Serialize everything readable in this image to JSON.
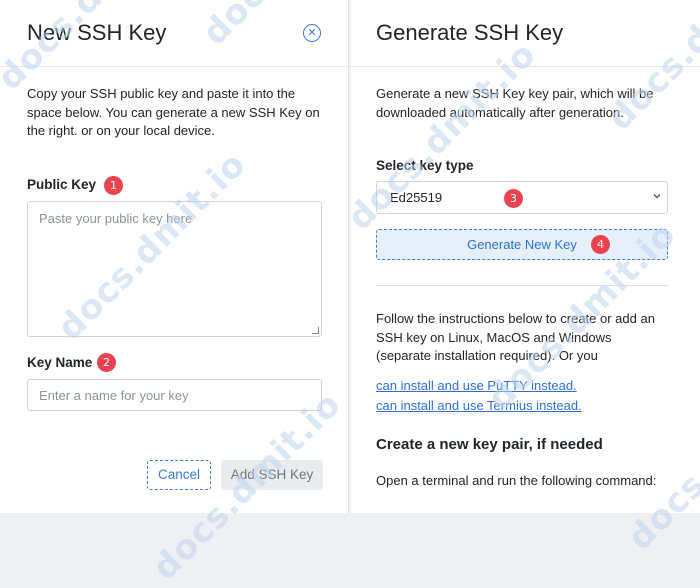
{
  "left": {
    "title": "New SSH Key",
    "close_icon": "close-icon",
    "description": "Copy your SSH public key and paste it into the space below. You can generate a new SSH Key on the right. or on your local device.",
    "public_key": {
      "label": "Public Key",
      "badge": "1",
      "placeholder": "Paste your public key here"
    },
    "key_name": {
      "label": "Key Name",
      "badge": "2",
      "placeholder": "Enter a name for your key"
    },
    "buttons": {
      "cancel": "Cancel",
      "add": "Add SSH Key"
    }
  },
  "right": {
    "title": "Generate SSH Key",
    "description": "Generate a new SSH Key key pair, which will be downloaded automatically after generation.",
    "select_label": "Select key type",
    "select_value": "Ed25519",
    "select_badge": "3",
    "generate_button": "Generate New Key",
    "generate_badge": "4",
    "instructions": "Follow the instructions below to create or add an SSH key on Linux, MacOS and Windows (separate installation required). Or you",
    "links": [
      "can install and use PuTTY instead.",
      "can install and use Termius instead."
    ],
    "subheading": "Create a new key pair, if needed",
    "command_intro": "Open a terminal and run the following command:"
  },
  "watermark": "docs.dmit.io",
  "colors": {
    "accent": "#3b7ddd",
    "badge": "#e8434f",
    "link": "#2f6fd6"
  }
}
